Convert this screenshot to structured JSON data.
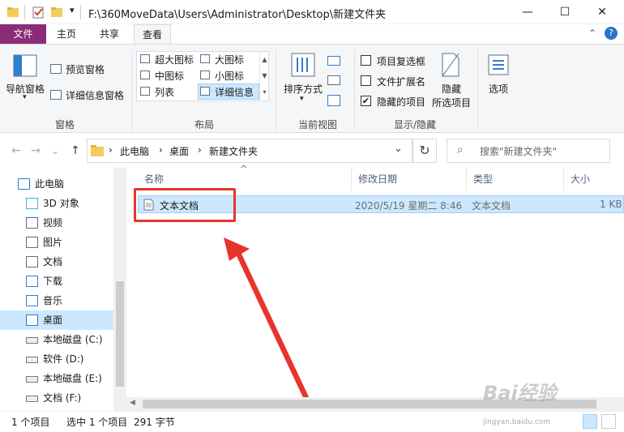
{
  "window": {
    "title": "F:\\360MoveData\\Users\\Administrator\\Desktop\\新建文件夹",
    "controls": {
      "minimize": "—",
      "maximize": "☐",
      "close": "✕"
    },
    "quick_access_dropdown": "▾"
  },
  "ribbon": {
    "tabs": [
      {
        "label": "文件",
        "active": false
      },
      {
        "label": "主页",
        "active": false
      },
      {
        "label": "共享",
        "active": false
      },
      {
        "label": "查看",
        "active": true
      }
    ],
    "collapse_glyph": "⌃",
    "help_glyph": "?",
    "groups": {
      "panes": {
        "label": "窗格",
        "nav_pane": "导航窗格",
        "preview_pane": "预览窗格",
        "details_pane": "详细信息窗格"
      },
      "layout": {
        "label": "布局",
        "items": [
          "超大图标",
          "大图标",
          "中图标",
          "小图标",
          "列表",
          "详细信息"
        ],
        "selected": "详细信息"
      },
      "current_view": {
        "label": "当前视图",
        "sort_by": "排序方式"
      },
      "show_hide": {
        "label": "显示/隐藏",
        "item_checkboxes": {
          "label": "项目复选框",
          "checked": false
        },
        "file_extensions": {
          "label": "文件扩展名",
          "checked": false
        },
        "hidden_items": {
          "label": "隐藏的项目",
          "checked": true
        },
        "hide_selected_line1": "隐藏",
        "hide_selected_line2": "所选项目"
      },
      "options": {
        "label": "选项"
      }
    }
  },
  "address": {
    "back": "←",
    "forward": "→",
    "recent": "⌄",
    "up": "↑",
    "breadcrumb": [
      "此电脑",
      "桌面",
      "新建文件夹"
    ],
    "separator": "›",
    "dropdown": "⌄",
    "refresh": "↻",
    "search_placeholder": "搜索\"新建文件夹\"",
    "search_glyph": "⌕"
  },
  "nav_pane": {
    "items": [
      {
        "label": "此电脑",
        "icon": "computer-icon",
        "selected": false
      },
      {
        "label": "3D 对象",
        "icon": "cube-icon",
        "selected": false
      },
      {
        "label": "视频",
        "icon": "video-icon",
        "selected": false
      },
      {
        "label": "图片",
        "icon": "picture-icon",
        "selected": false
      },
      {
        "label": "文档",
        "icon": "document-icon",
        "selected": false
      },
      {
        "label": "下载",
        "icon": "download-icon",
        "selected": false
      },
      {
        "label": "音乐",
        "icon": "music-icon",
        "selected": false
      },
      {
        "label": "桌面",
        "icon": "desktop-icon",
        "selected": true
      },
      {
        "label": "本地磁盘 (C:)",
        "icon": "drive-icon",
        "selected": false
      },
      {
        "label": "软件 (D:)",
        "icon": "drive-icon",
        "selected": false
      },
      {
        "label": "本地磁盘 (E:)",
        "icon": "drive-icon",
        "selected": false
      },
      {
        "label": "文档 (F:)",
        "icon": "drive-icon",
        "selected": false
      }
    ]
  },
  "file_list": {
    "columns": [
      "名称",
      "修改日期",
      "类型",
      "大小"
    ],
    "sort_glyph": "^",
    "rows": [
      {
        "name": "文本文档",
        "date": "2020/5/19 星期二 8:46",
        "type": "文本文档",
        "size": "1 KB"
      }
    ]
  },
  "status": {
    "item_count": "1 个项目",
    "selected": "选中 1 个项目",
    "size": "291 字节"
  },
  "watermark": {
    "line1": "Bai经验",
    "line2": "jingyan.baidu.com"
  },
  "colors": {
    "file_tab": "#8b2c78",
    "selection": "#cce8ff",
    "highlight_box": "#e8342e",
    "arrow": "#e8342e"
  }
}
